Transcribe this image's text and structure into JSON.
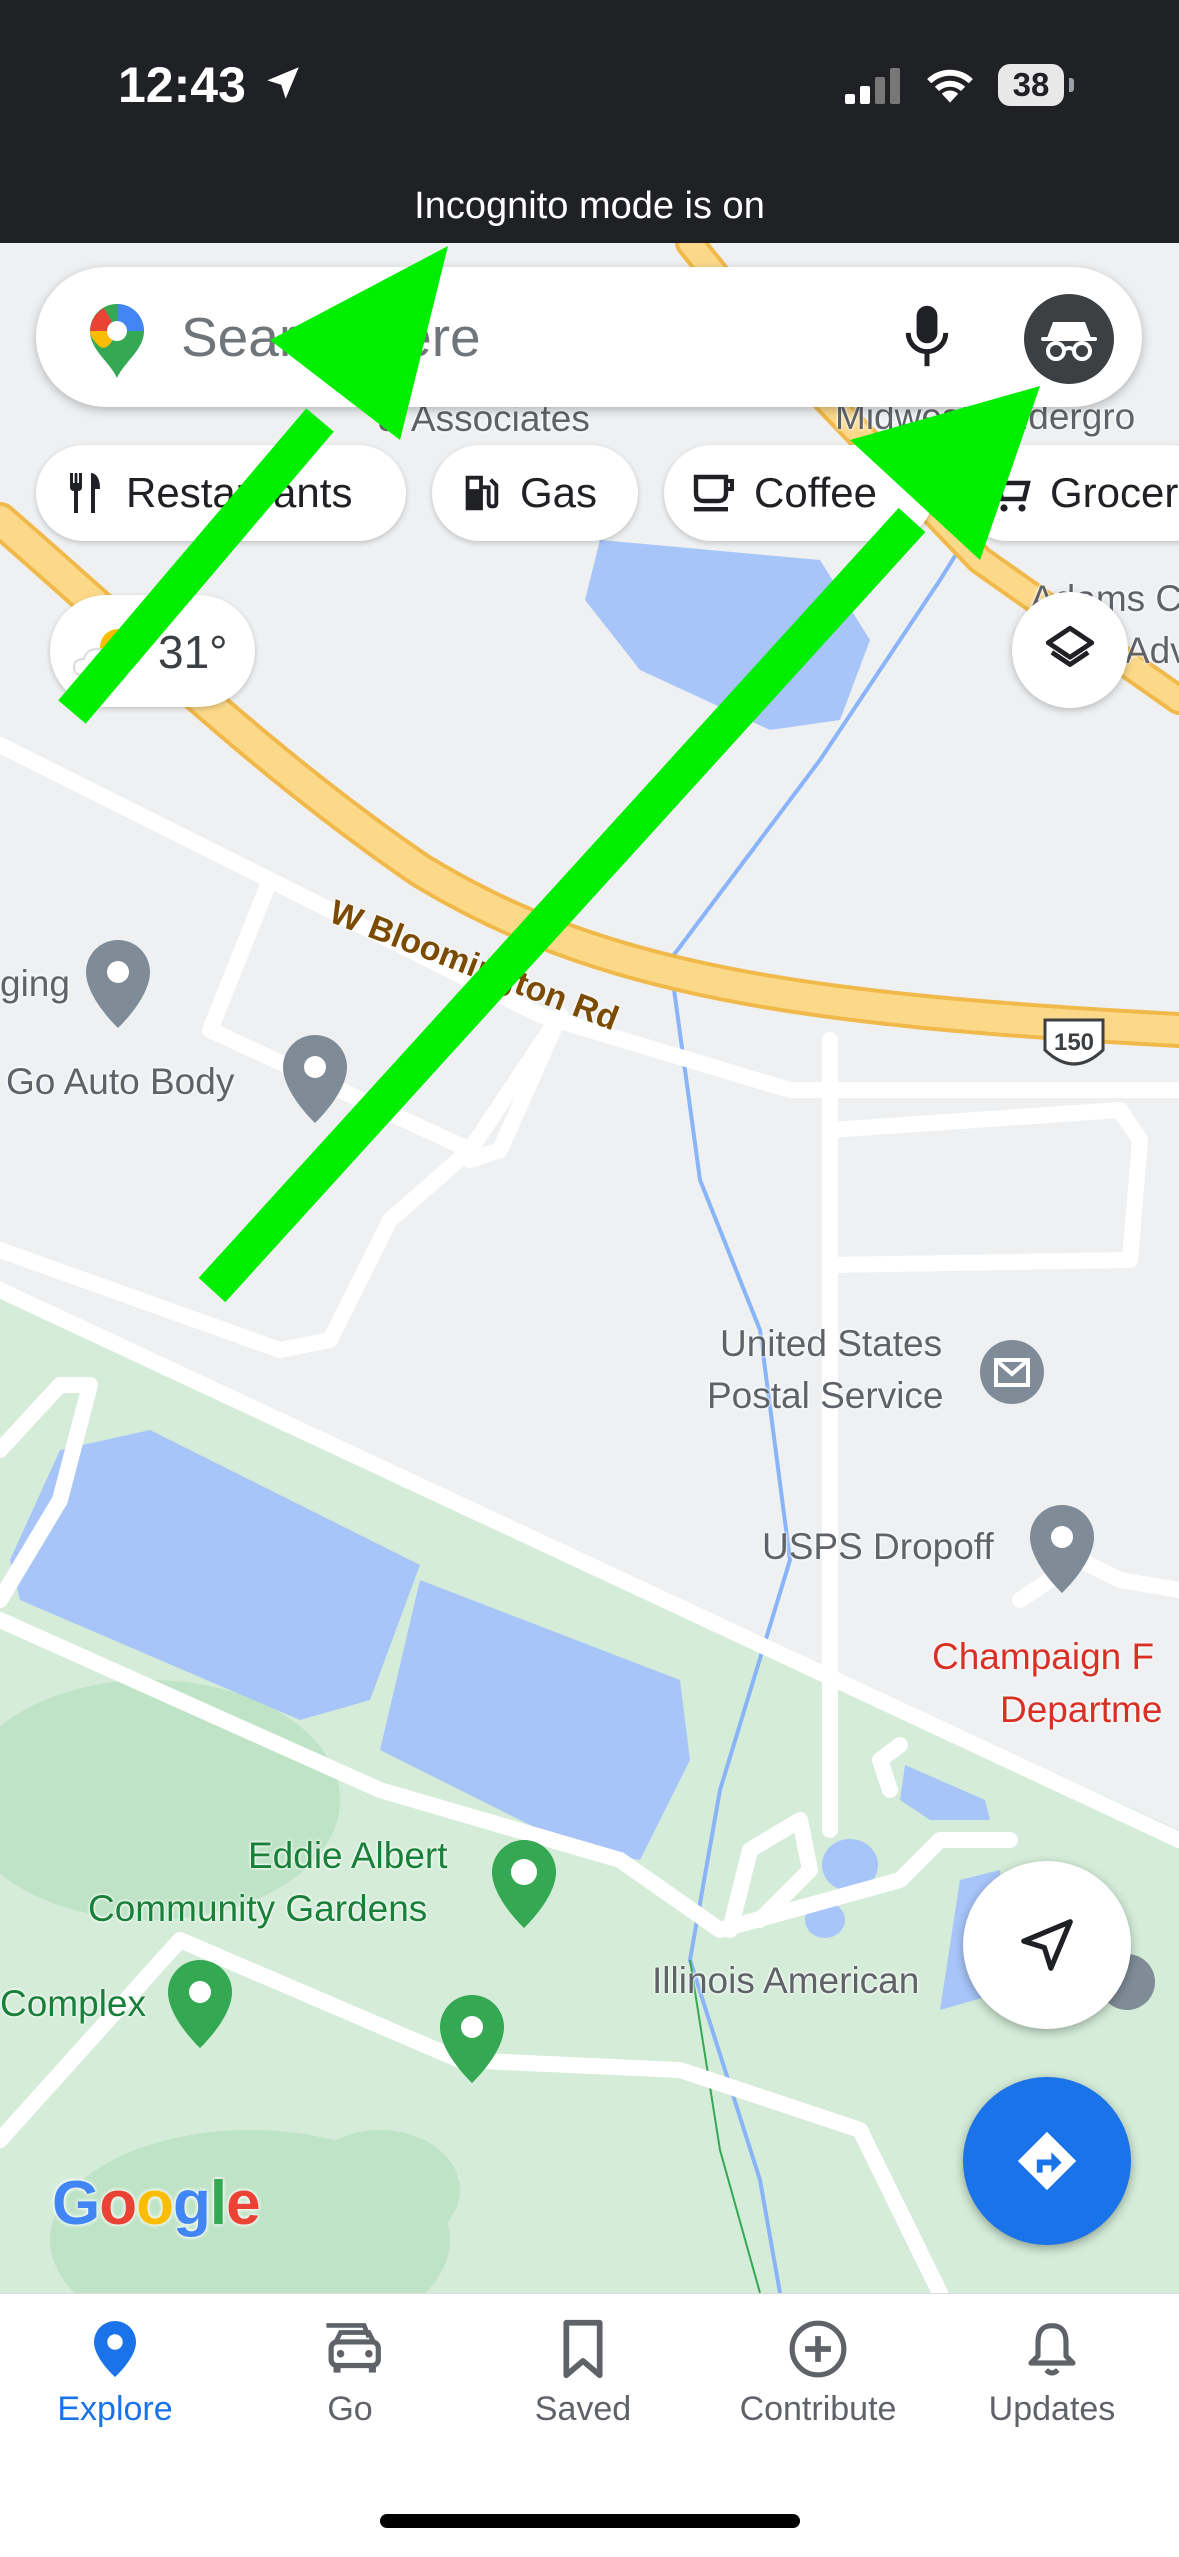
{
  "status_bar": {
    "time": "12:43",
    "battery": "38"
  },
  "banner": {
    "text": "Incognito mode is on"
  },
  "search": {
    "placeholder": "Search here"
  },
  "chips": [
    {
      "label": "Restaurants",
      "icon": "fork-knife-icon"
    },
    {
      "label": "Gas",
      "icon": "gas-pump-icon"
    },
    {
      "label": "Coffee",
      "icon": "coffee-cup-icon"
    },
    {
      "label": "Groceries",
      "icon": "shopping-cart-icon"
    }
  ],
  "weather": {
    "temp": "31°",
    "icon": "partly-sunny-icon"
  },
  "map_labels": {
    "associates": "& Associates",
    "midwest": "Midwest Undergro",
    "adams": "Adams C",
    "adams2": "Adv",
    "road": "W Bloomington Rd",
    "route_shield": "150",
    "lodging": "ging",
    "auto_body": "Go Auto Body",
    "usps_1": "United States",
    "usps_2": "Postal Service",
    "usps_dropoff": "USPS Dropoff",
    "champaign_1": "Champaign F",
    "champaign_2": "Departme",
    "eddie_1": "Eddie Albert",
    "eddie_2": "Community Gardens",
    "complex": "Complex",
    "illinois_american": "Illinois American",
    "google": "Google"
  },
  "nav": [
    {
      "label": "Explore",
      "icon": "location-pin-icon",
      "active": true
    },
    {
      "label": "Go",
      "icon": "car-icon",
      "active": false
    },
    {
      "label": "Saved",
      "icon": "bookmark-icon",
      "active": false
    },
    {
      "label": "Contribute",
      "icon": "plus-circle-icon",
      "active": false
    },
    {
      "label": "Updates",
      "icon": "bell-icon",
      "active": false
    }
  ],
  "colors": {
    "accent": "#1a73e8",
    "annotation_arrow": "#00ee00",
    "road": "#fcd07a",
    "park": "#d4ecd8",
    "water": "#a8c5f9"
  }
}
